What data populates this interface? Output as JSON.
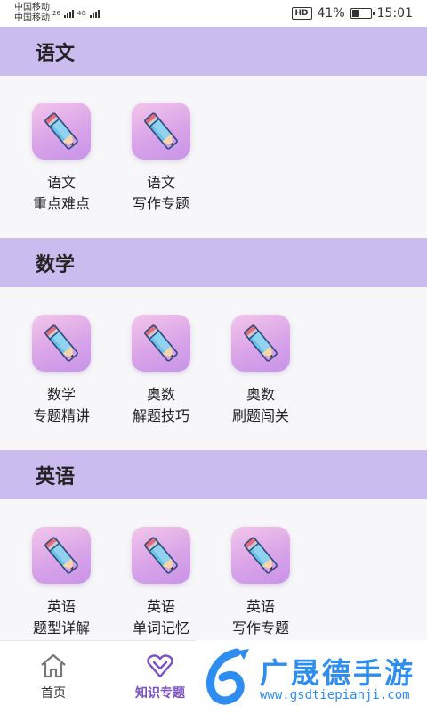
{
  "status_bar": {
    "carrier_1": "中国移动",
    "carrier_2": "中国移动",
    "net_1": "26",
    "net_2": "4G",
    "battery_text": "41%",
    "battery_level": 0.41,
    "hd_badge": "HD",
    "time": "15:01"
  },
  "sections": [
    {
      "title": "语文",
      "items": [
        {
          "line1": "语文",
          "line2": "重点难点"
        },
        {
          "line1": "语文",
          "line2": "写作专题"
        }
      ]
    },
    {
      "title": "数学",
      "items": [
        {
          "line1": "数学",
          "line2": "专题精讲"
        },
        {
          "line1": "奥数",
          "line2": "解题技巧"
        },
        {
          "line1": "奥数",
          "line2": "刷题闯关"
        }
      ]
    },
    {
      "title": "英语",
      "items": [
        {
          "line1": "英语",
          "line2": "题型详解"
        },
        {
          "line1": "英语",
          "line2": "单词记忆"
        },
        {
          "line1": "英语",
          "line2": "写作专题"
        }
      ]
    }
  ],
  "bottom_nav": {
    "home_label": "首页",
    "knowledge_label": "知识专题"
  },
  "watermark": {
    "title": "广晟德手游",
    "url": "www.gsdtiepianji.com"
  },
  "colors": {
    "section_header": "#cbbcf0",
    "active_nav": "#7a4fc7",
    "watermark": "#2d8df0"
  },
  "icons": {
    "tile": "pencil-icon",
    "home": "home-icon",
    "knowledge": "heart-chevron-icon"
  }
}
